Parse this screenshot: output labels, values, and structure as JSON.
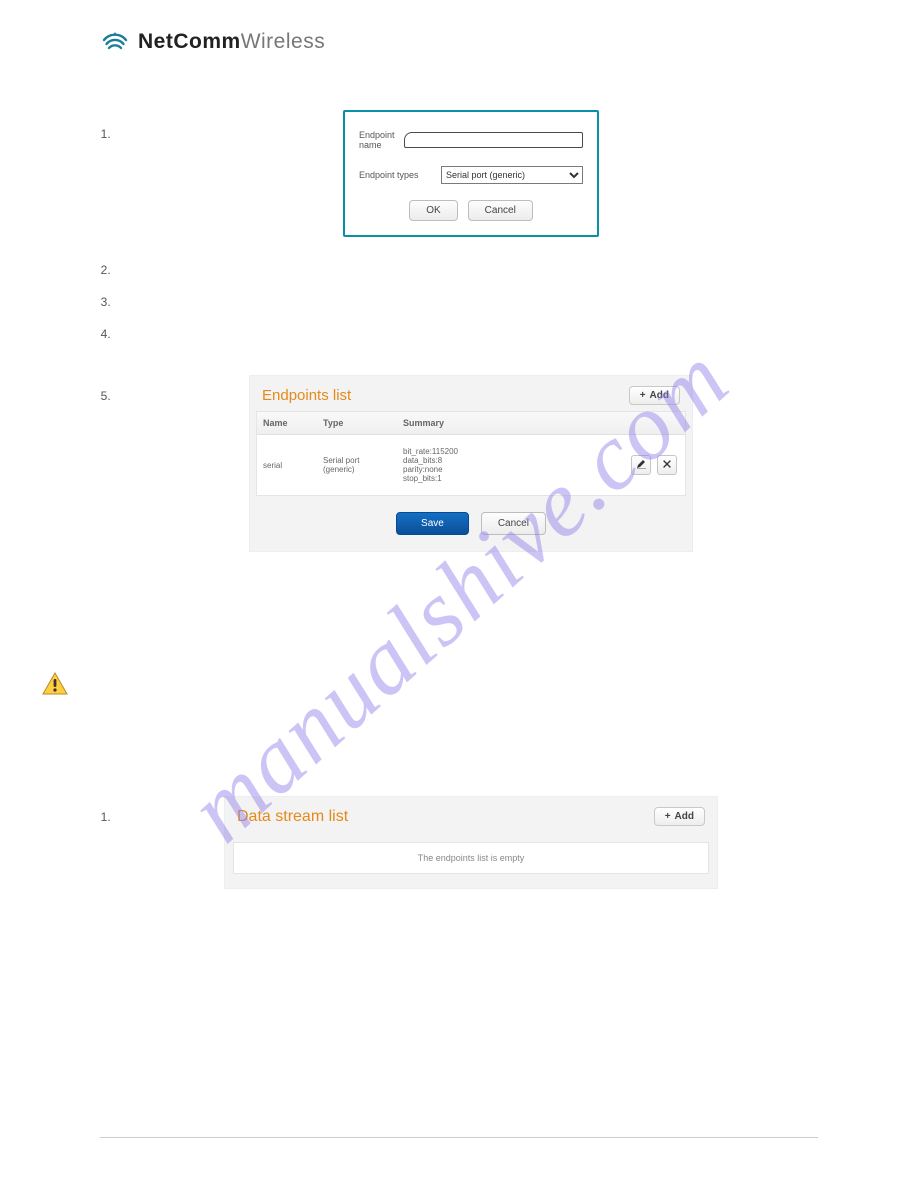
{
  "brand": {
    "bold": "NetComm",
    "light": "Wireless"
  },
  "watermark": "manualshive.com",
  "steps_a": [
    "",
    "",
    "",
    "",
    ""
  ],
  "modal": {
    "label_name": "Endpoint name",
    "label_types": "Endpoint types",
    "name_value": "",
    "types_selected": "Serial port (generic)",
    "ok": "OK",
    "cancel": "Cancel"
  },
  "endpoints_panel": {
    "title": "Endpoints list",
    "add_label": "Add",
    "cols": {
      "name": "Name",
      "type": "Type",
      "summary": "Summary"
    },
    "row": {
      "name": "serial",
      "type": "Serial port\n(generic)",
      "summary": "bit_rate:115200\ndata_bits:8\nparity:none\nstop_bits:1"
    },
    "save": "Save",
    "cancel": "Cancel"
  },
  "steps_b": [
    ""
  ],
  "streams_panel": {
    "title": "Data stream list",
    "add_label": "Add",
    "empty": "The endpoints list is empty"
  }
}
